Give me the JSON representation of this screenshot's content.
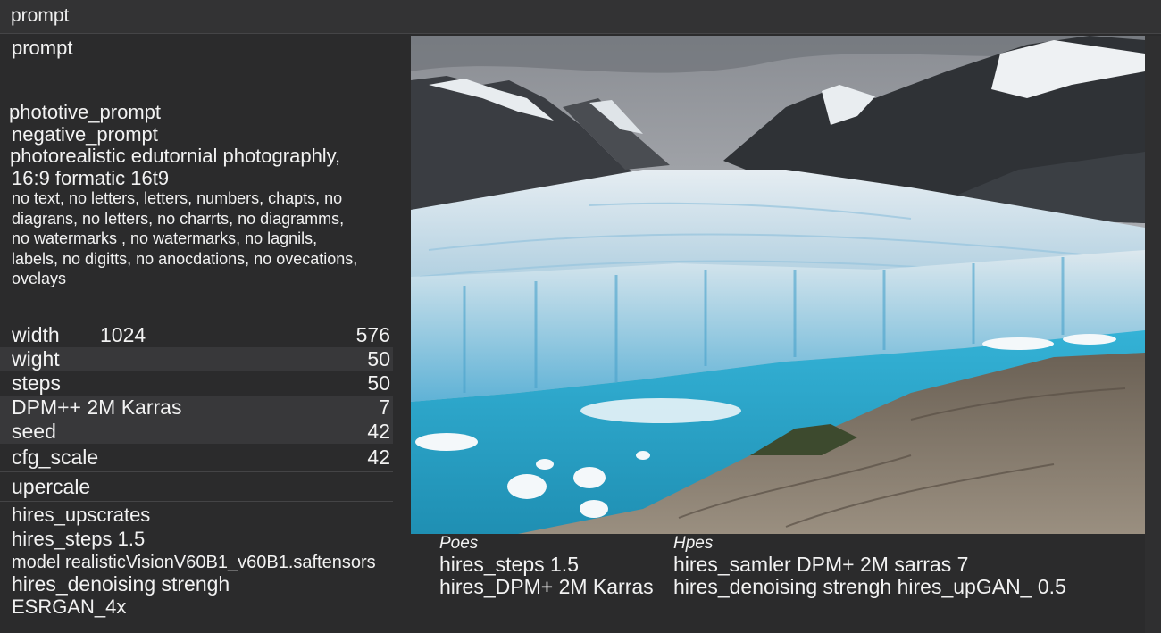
{
  "window": {
    "title": "prompt"
  },
  "left": {
    "prompt_label": "prompt",
    "prompt_positive_label": "phototive_prompt",
    "negative_label": "negative_prompt",
    "style_line1": "photorealistic edutornial photographly,",
    "style_line2": "16:9 formatic 16t9",
    "negative_lines": [
      "no text, no letters, letters, numbers, chapts, no",
      "diagrans, no letters, no charrts, no diagramms,",
      "no watermarks , no watermarks, no lagnils,",
      "labels, no digitts, no anocdations, no ovecations,",
      "ovelays"
    ],
    "params": [
      {
        "key": "width",
        "mid": "1024",
        "value": "576"
      },
      {
        "key": "wight",
        "value": "50"
      },
      {
        "key": "steps",
        "value": "50"
      },
      {
        "key": "DPM++ 2M Karras",
        "value": "7"
      },
      {
        "key": "seed",
        "value": "42"
      },
      {
        "key": "cfg_scale",
        "value": "42"
      }
    ],
    "upscale_label": "upercale",
    "hires_upscale": "hires_upscrates",
    "hires_steps": "hires_steps  1.5",
    "model": "model realisticVisionV60B1_v60B1.saftensors",
    "hires_denoising": "hires_denoising strengh",
    "upscaler": "ESRGAN_4x"
  },
  "bottom": {
    "col1": {
      "heading": "Poes",
      "line1": "hires_steps    1.5",
      "line2": "hires_DPM+ 2M Karras"
    },
    "col2": {
      "heading": "Hpes",
      "line1": "hires_samler DPM+ 2M sarras 7",
      "line2": "hires_denoising strengh hires_upGAN_ 0.5"
    }
  },
  "colors": {
    "background": "#2b2b2c",
    "text": "#f2f2f2",
    "glacier_blue": "#2c9ec4"
  }
}
